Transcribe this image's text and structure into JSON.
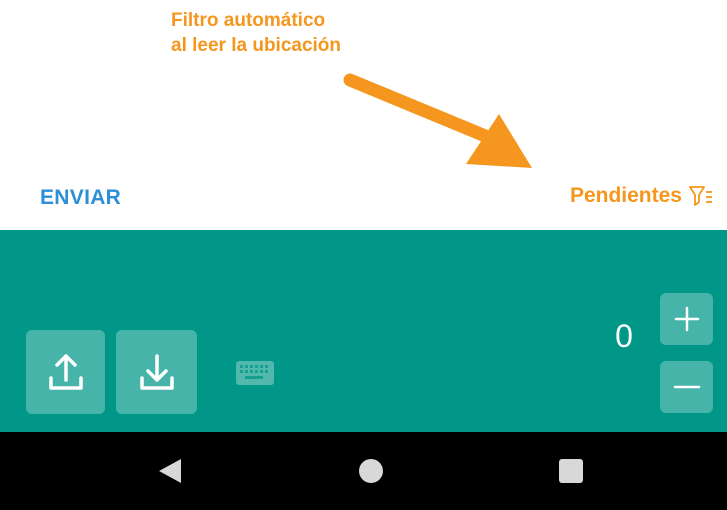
{
  "annotation": {
    "line1": "Filtro automático",
    "line2": "al leer la ubicación",
    "color": "#f5961e"
  },
  "header": {
    "send_label": "ENVIAR",
    "filter_label": "Pendientes",
    "filter_icon": "filter-list-icon"
  },
  "panel": {
    "background": "#009788",
    "upload_icon": "upload-icon",
    "download_icon": "download-icon",
    "keyboard_icon": "keyboard-icon",
    "quantity": "0",
    "plus_icon": "plus-icon",
    "minus_icon": "minus-icon"
  },
  "navigation": {
    "back_icon": "back-triangle-icon",
    "home_icon": "home-circle-icon",
    "recents_icon": "recents-square-icon"
  },
  "colors": {
    "accent_orange": "#f5961e",
    "accent_blue": "#2d8fd6",
    "panel_teal": "#009788"
  }
}
